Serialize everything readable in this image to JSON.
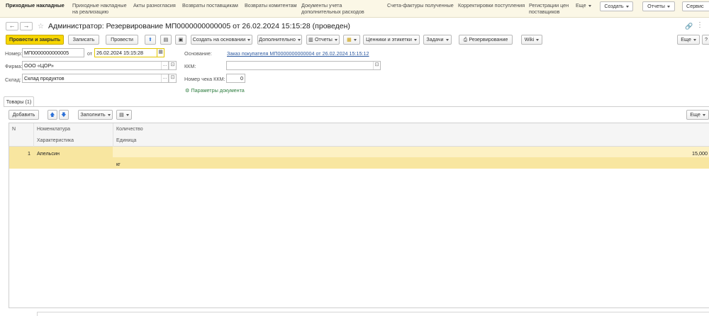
{
  "topnav": {
    "items": [
      "Приходные накладные",
      "Приходные накладные на реализацию",
      "Акты разногласия",
      "Возвраты поставщикам",
      "Возвраты комитентам",
      "Документы учета дополнительных расходов",
      "Счета-фактуры полученные",
      "Корректировки поступления",
      "Регистрации цен поставщиков",
      "Еще"
    ],
    "create_label": "Создать",
    "reports_label": "Отчеты",
    "service_label": "Сервис"
  },
  "window": {
    "title": "Администратор: Резервирование МП0000000000005 от 26.02.2024 15:15:28 (проведен)"
  },
  "toolbar": {
    "post_close": "Провести и закрыть",
    "save": "Записать",
    "post": "Провести",
    "create_based": "Создать на основании",
    "additional": "Дополнительно",
    "reports": "Отчеты",
    "price_tags": "Ценники и этикетки",
    "tasks": "Задачи",
    "reservation": "Резервирование",
    "wiki": "Wiki",
    "more": "Еще",
    "help": "?"
  },
  "form": {
    "number_label": "Номер:",
    "number_value": "МП0000000000005",
    "date_label": "от",
    "date_value": "26.02.2024 15:15:28",
    "firm_label": "Фирма:",
    "firm_value": "ООО «ЦОР»",
    "warehouse_label": "Склад:",
    "warehouse_value": "Склад продуктов",
    "basis_label": "Основание:",
    "basis_value": "Заказ покупателя МП0000000000004 от 26.02.2024 15:15:12",
    "kkm_label": "ККМ:",
    "kkm_value": "",
    "check_label": "Номер чека ККМ:",
    "check_value": "0",
    "params_link": "Параметры документа"
  },
  "tabs": [
    {
      "label": "Товары (1)"
    }
  ],
  "table_toolbar": {
    "add": "Добавить",
    "fill": "Заполнить",
    "more": "Еще"
  },
  "table": {
    "headers": {
      "n": "N",
      "nomenclature": "Номенклатура",
      "characteristic": "Характеристика",
      "quantity": "Количество",
      "unit": "Единица"
    },
    "rows": [
      {
        "n": "1",
        "nomenclature": "Апельсин",
        "characteristic": "",
        "quantity": "15,000",
        "unit": "кг"
      }
    ]
  },
  "colors": {
    "accent": "#f7d600",
    "row_selected": "#fdf1c3",
    "link": "#2d5aa0",
    "topbar": "#fbf7e6"
  }
}
